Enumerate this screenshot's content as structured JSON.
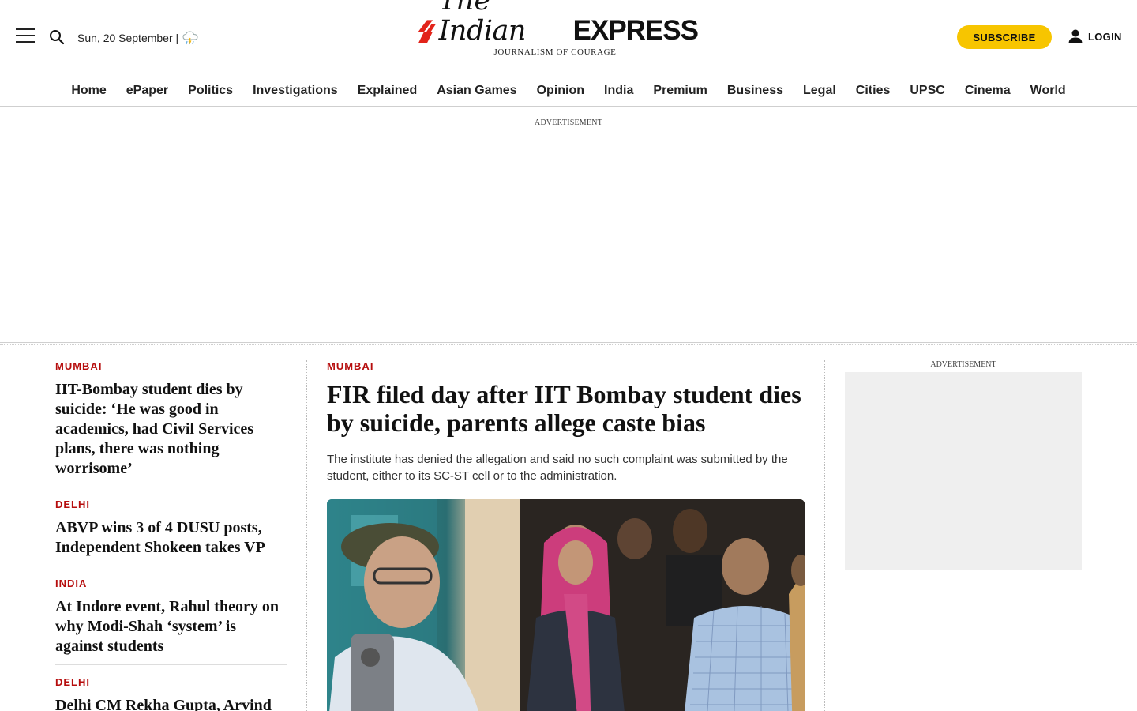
{
  "header": {
    "date": "Sun, 20 September |",
    "logo_the": "The Indian",
    "logo_express": "EXPRESS",
    "logo_tagline": "JOURNALISM OF COURAGE",
    "subscribe_label": "SUBSCRIBE",
    "login_label": "LOGIN"
  },
  "nav": {
    "items": [
      "Home",
      "ePaper",
      "Politics",
      "Investigations",
      "Explained",
      "Asian Games",
      "Opinion",
      "India",
      "Premium",
      "Business",
      "Legal",
      "Cities",
      "UPSC",
      "Cinema",
      "World"
    ]
  },
  "ads": {
    "top_label": "ADVERTISEMENT",
    "side_label": "ADVERTISEMENT"
  },
  "left_stories": [
    {
      "kicker": "MUMBAI",
      "title": "IIT-Bombay student dies by suicide: ‘He was good in academics, had Civil Services plans, there was nothing worrisome’"
    },
    {
      "kicker": "DELHI",
      "title": "ABVP wins 3 of 4 DUSU posts, Independent Shokeen takes VP"
    },
    {
      "kicker": "INDIA",
      "title": "At Indore event, Rahul theory on why Modi-Shah ‘system’ is against students"
    },
    {
      "kicker": "DELHI",
      "title": "Delhi CM Rekha Gupta, Arvind"
    }
  ],
  "lead_story": {
    "kicker": "MUMBAI",
    "title": "FIR filed day after IIT Bombay student dies by suicide, parents allege caste bias",
    "summary": "The institute has denied the allegation and said no such complaint was submitted by the student, either to its SC-ST cell or to the administration."
  },
  "colors": {
    "accent_red": "#b60d0d",
    "subscribe_yellow": "#f7c500",
    "logo_red": "#e2231a"
  }
}
